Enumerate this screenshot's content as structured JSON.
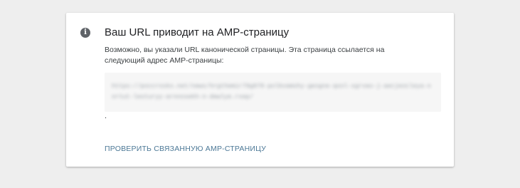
{
  "card": {
    "icon": "info-icon",
    "icon_glyph": "i",
    "title": "Ваш URL приводит на AMP-страницу",
    "description": "Возможно, вы указали URL канонической страницы. Эта страница ссылается на следующий адрес AMP-страницы:",
    "url_blurred": "https://poccrosko.net/news/hrgthemir79g978-polbvamshy-geogne-qool-sgrvao-j-aecjeocleya-nortut-lesturyy-arnnosekh-n-dewlye.rxep/",
    "trailing_dot": ".",
    "check_button_label": "ПРОВЕРИТЬ СВЯЗАННУЮ AMP-СТРАНИЦУ"
  },
  "colors": {
    "page_background": "#eeeeee",
    "card_background": "#ffffff",
    "link": "#4c7896",
    "icon": "#5f6368"
  }
}
